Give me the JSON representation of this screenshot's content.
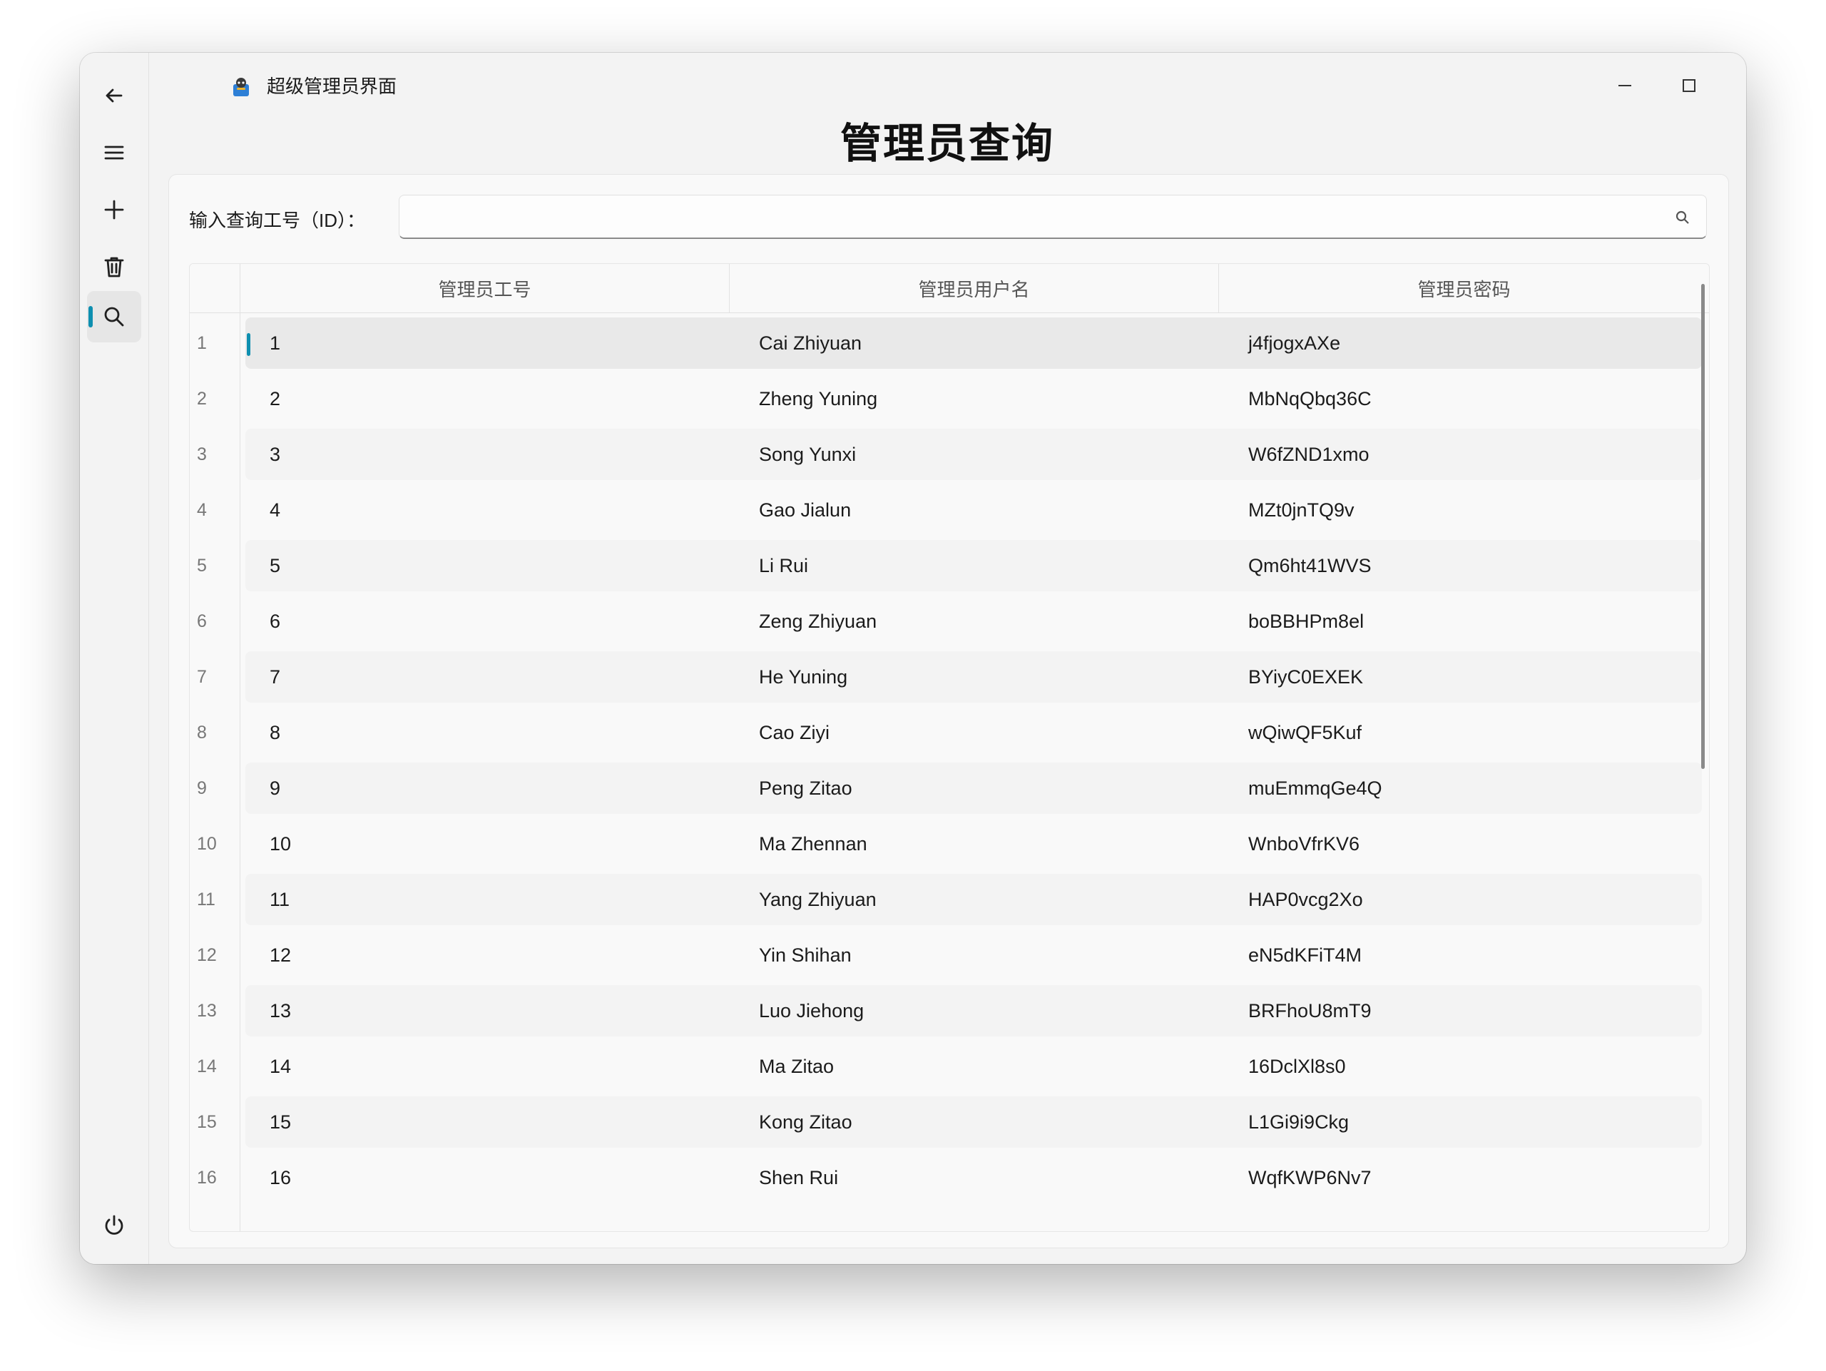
{
  "window": {
    "title": "超级管理员界面"
  },
  "sidebar": {
    "items": [
      {
        "name": "back",
        "icon": "back-arrow-icon"
      },
      {
        "name": "menu",
        "icon": "hamburger-menu-icon"
      },
      {
        "name": "add",
        "icon": "plus-icon"
      },
      {
        "name": "delete",
        "icon": "trash-icon"
      },
      {
        "name": "search",
        "icon": "search-icon",
        "active": true
      },
      {
        "name": "power",
        "icon": "power-icon"
      }
    ],
    "accent": "#0e8fb0"
  },
  "page": {
    "title": "管理员查询"
  },
  "search": {
    "label": "输入查询工号（ID）：",
    "value": "",
    "placeholder": ""
  },
  "table": {
    "columns": [
      "管理员工号",
      "管理员用户名",
      "管理员密码"
    ],
    "rows": [
      {
        "num": "1",
        "id": "1",
        "username": "Cai Zhiyuan",
        "password": "j4fjogxAXe"
      },
      {
        "num": "2",
        "id": "2",
        "username": "Zheng Yuning",
        "password": "MbNqQbq36C"
      },
      {
        "num": "3",
        "id": "3",
        "username": "Song Yunxi",
        "password": "W6fZND1xmo"
      },
      {
        "num": "4",
        "id": "4",
        "username": "Gao Jialun",
        "password": "MZt0jnTQ9v"
      },
      {
        "num": "5",
        "id": "5",
        "username": "Li Rui",
        "password": "Qm6ht41WVS"
      },
      {
        "num": "6",
        "id": "6",
        "username": "Zeng Zhiyuan",
        "password": "boBBHPm8el"
      },
      {
        "num": "7",
        "id": "7",
        "username": "He Yuning",
        "password": "BYiyC0EXEK"
      },
      {
        "num": "8",
        "id": "8",
        "username": "Cao Ziyi",
        "password": "wQiwQF5Kuf"
      },
      {
        "num": "9",
        "id": "9",
        "username": "Peng Zitao",
        "password": "muEmmqGe4Q"
      },
      {
        "num": "10",
        "id": "10",
        "username": "Ma Zhennan",
        "password": "WnboVfrKV6"
      },
      {
        "num": "11",
        "id": "11",
        "username": "Yang Zhiyuan",
        "password": "HAP0vcg2Xo"
      },
      {
        "num": "12",
        "id": "12",
        "username": "Yin Shihan",
        "password": "eN5dKFiT4M"
      },
      {
        "num": "13",
        "id": "13",
        "username": "Luo Jiehong",
        "password": "BRFhoU8mT9"
      },
      {
        "num": "14",
        "id": "14",
        "username": "Ma Zitao",
        "password": "16DclXl8s0"
      },
      {
        "num": "15",
        "id": "15",
        "username": "Kong Zitao",
        "password": "L1Gi9i9Ckg"
      },
      {
        "num": "16",
        "id": "16",
        "username": "Shen Rui",
        "password": "WqfKWP6Nv7"
      }
    ],
    "selected_row": 0
  }
}
